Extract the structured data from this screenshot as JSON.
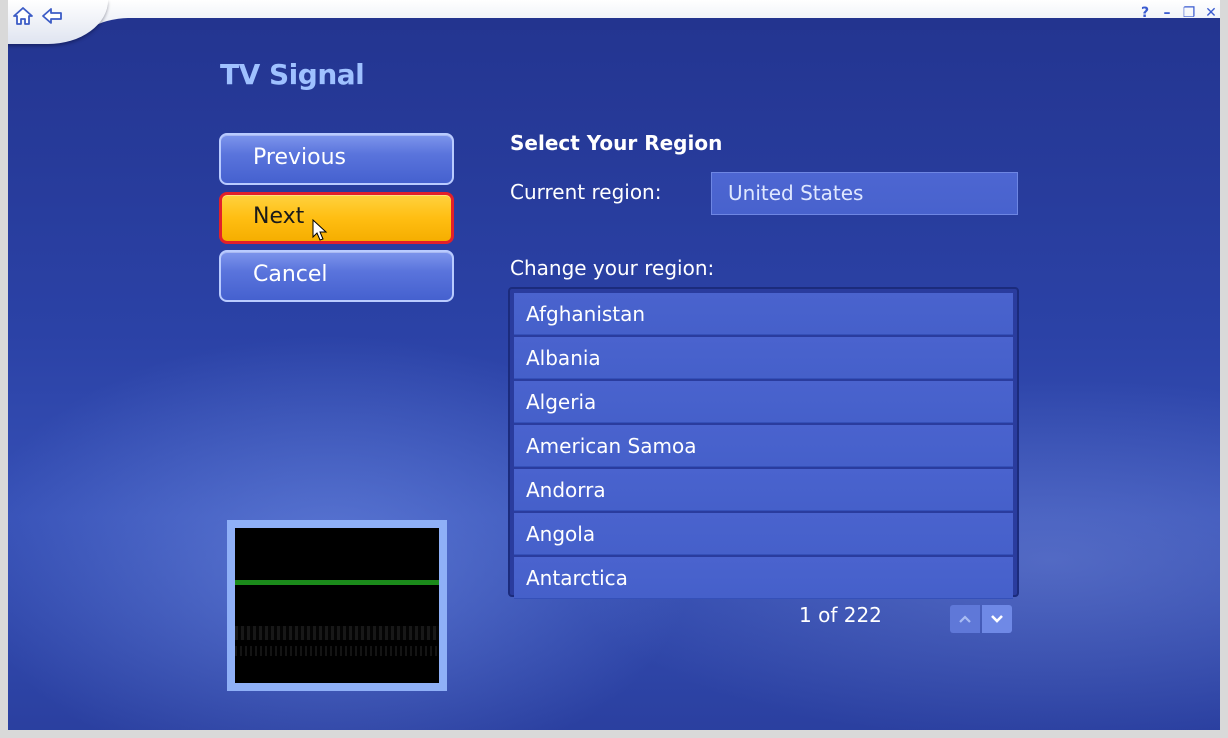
{
  "window": {
    "title": "TV Signal"
  },
  "icons": {
    "home": "home-icon",
    "back": "back-arrow-icon",
    "help": "help-icon",
    "minimize": "minimize-icon",
    "restore": "restore-icon",
    "close": "close-icon"
  },
  "buttons": {
    "previous": "Previous",
    "next": "Next",
    "cancel": "Cancel"
  },
  "section": {
    "title": "Select Your Region",
    "current_label": "Current region:",
    "current_value": "United States",
    "change_label": "Change your region:"
  },
  "regions": [
    "Afghanistan",
    "Albania",
    "Algeria",
    "American Samoa",
    "Andorra",
    "Angola",
    "Antarctica"
  ],
  "pager": {
    "count_text": "1 of 222"
  },
  "colors": {
    "accent_selected": "#ffbe12",
    "selection_border": "#e2202a",
    "title_text": "#9fc1ff",
    "background": "#2b42a6"
  }
}
